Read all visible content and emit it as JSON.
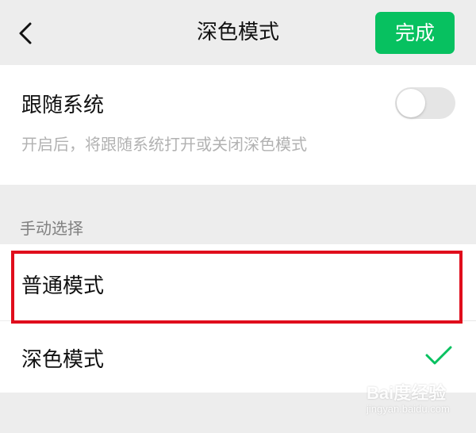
{
  "header": {
    "title": "深色模式",
    "done_label": "完成"
  },
  "follow_system": {
    "label": "跟随系统",
    "description": "开启后，将跟随系统打开或关闭深色模式",
    "enabled": false
  },
  "manual": {
    "section_label": "手动选择",
    "options": [
      {
        "label": "普通模式",
        "selected": false
      },
      {
        "label": "深色模式",
        "selected": true
      }
    ]
  },
  "watermark": {
    "text": "Bai度经验",
    "url": "jingyan.baidu.com"
  },
  "colors": {
    "accent": "#07c160",
    "highlight": "#e00d1c",
    "background": "#ededed"
  }
}
